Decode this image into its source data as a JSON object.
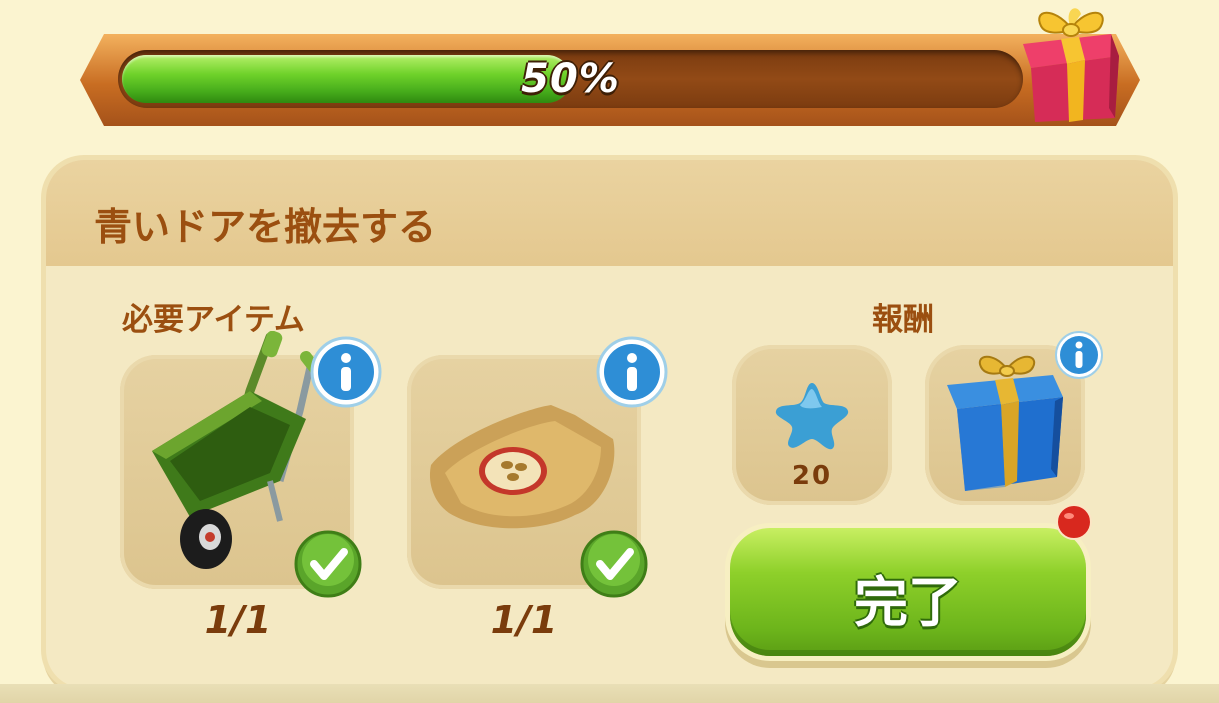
{
  "progress": {
    "value_percent": 50,
    "label": "50%"
  },
  "quest": {
    "title": "青いドアを撤去する",
    "required_label": "必要アイテム",
    "reward_label": "報酬",
    "items": [
      {
        "name": "wheelbarrow",
        "count": "1/1",
        "completed": true
      },
      {
        "name": "seed-bag",
        "count": "1/1",
        "completed": true
      }
    ],
    "rewards": [
      {
        "name": "blue-star",
        "amount": "20"
      },
      {
        "name": "blue-gift-box"
      }
    ],
    "complete_label": "完了"
  },
  "colors": {
    "accent_green": "#6cb41b",
    "title_brown": "#9b4f10",
    "count_brown": "#7a3c0c",
    "background": "#fbf4d0"
  }
}
